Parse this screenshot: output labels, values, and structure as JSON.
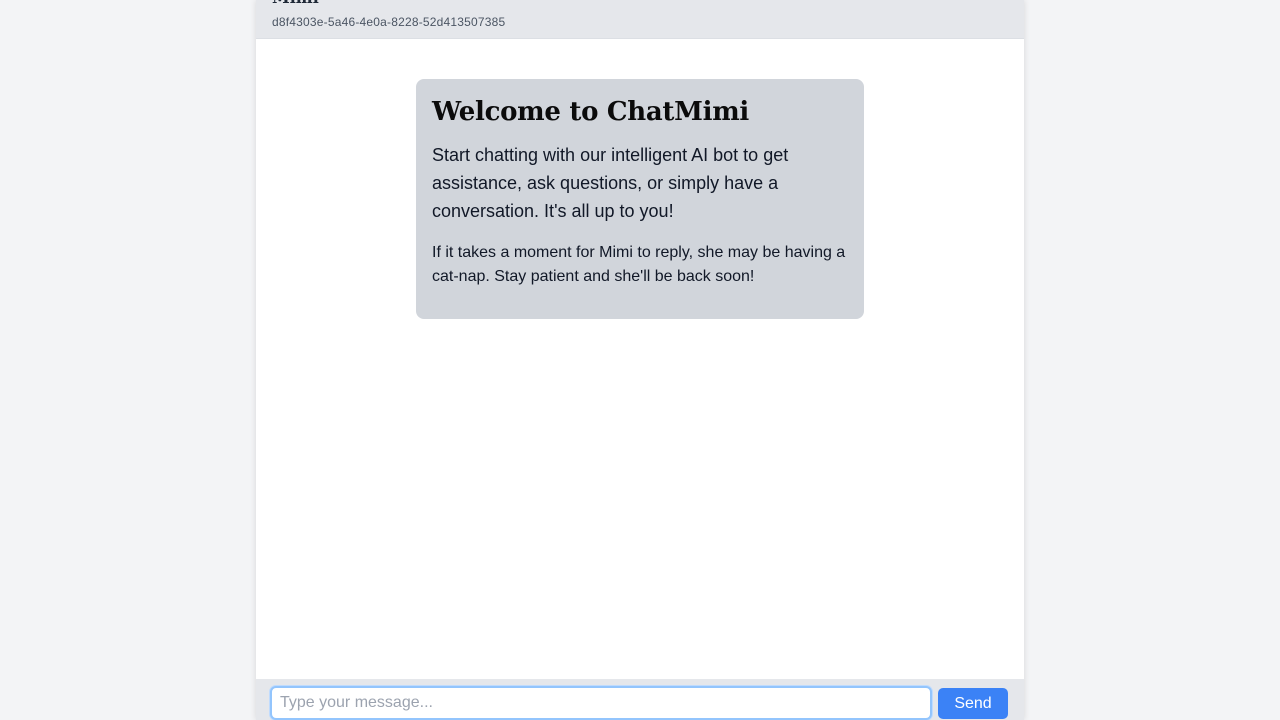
{
  "header": {
    "bot_name": "Mimi",
    "session_id": "d8f4303e-5a46-4e0a-8228-52d413507385"
  },
  "welcome": {
    "title": "Welcome to ChatMimi",
    "text": "Start chatting with our intelligent AI bot to get assistance, ask questions, or simply have a conversation. It's all up to you!",
    "note": "If it takes a moment for Mimi to reply, she may be having a cat-nap. Stay patient and she'll be back soon!"
  },
  "composer": {
    "placeholder": "Type your message...",
    "value": "",
    "send_label": "Send"
  },
  "colors": {
    "accent": "#3b82f6",
    "header_bg": "#e5e7eb",
    "card_bg": "#d1d5db",
    "page_bg": "#f3f4f6"
  }
}
